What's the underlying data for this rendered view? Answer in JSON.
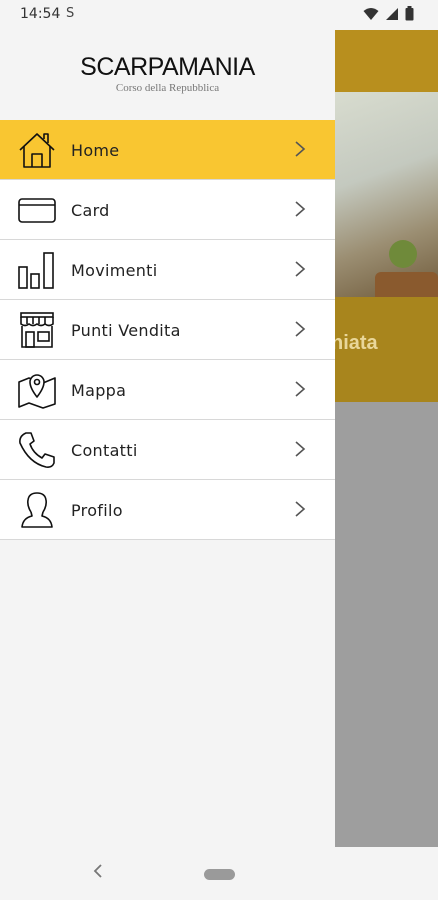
{
  "status_bar": {
    "time": "14:54",
    "indicator": "S"
  },
  "background": {
    "partial_text": "niata"
  },
  "brand": {
    "name": "SCARPAMANIA",
    "subtitle": "Corso della Repubblica"
  },
  "menu": [
    {
      "label": "Home",
      "icon": "home-icon",
      "active": true
    },
    {
      "label": "Card",
      "icon": "card-icon",
      "active": false
    },
    {
      "label": "Movimenti",
      "icon": "bar-chart-icon",
      "active": false
    },
    {
      "label": "Punti Vendita",
      "icon": "store-icon",
      "active": false
    },
    {
      "label": "Mappa",
      "icon": "map-icon",
      "active": false
    },
    {
      "label": "Contatti",
      "icon": "phone-icon",
      "active": false
    },
    {
      "label": "Profilo",
      "icon": "user-icon",
      "active": false
    }
  ],
  "colors": {
    "accent": "#f9c631",
    "background_app_header": "#b88f1e",
    "scrim": "#9e9e9e"
  }
}
